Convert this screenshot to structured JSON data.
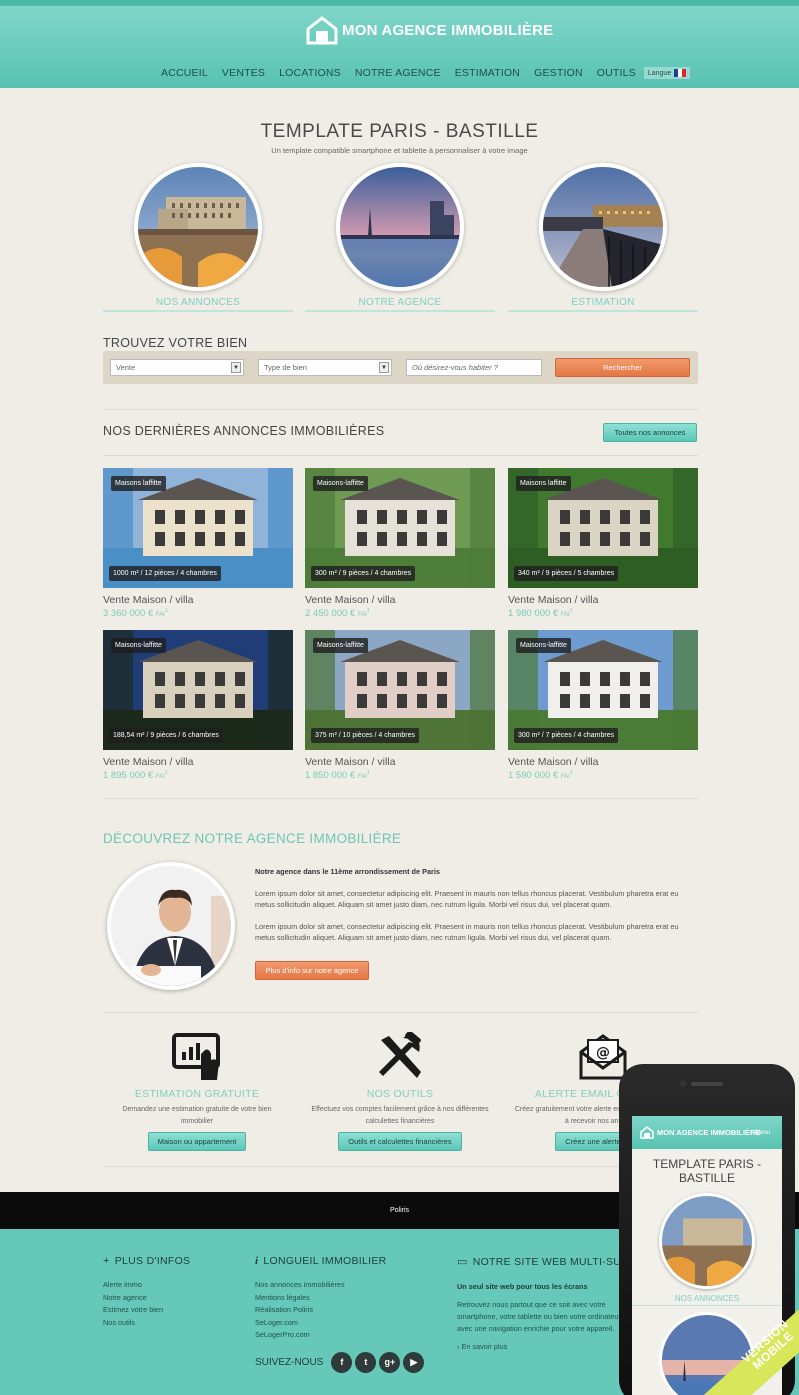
{
  "brand": {
    "name": "MON AGENCE IMMOBILIÈRE"
  },
  "nav": {
    "items": [
      "ACCUEIL",
      "VENTES",
      "LOCATIONS",
      "NOTRE AGENCE",
      "ESTIMATION",
      "GESTION",
      "OUTILS"
    ],
    "lang_label": "Langue"
  },
  "hero": {
    "title": "TEMPLATE PARIS - BASTILLE",
    "subtitle": "Un template compatible smartphone et tablette à personnaliser à votre image",
    "circles": [
      "NOS ANNONCES",
      "NOTRE AGENCE",
      "ESTIMATION"
    ]
  },
  "search": {
    "title": "TROUVEZ VOTRE BIEN",
    "select1": "Vente",
    "select2": "Type de bien",
    "placeholder": "Où désirez-vous habiter ?",
    "button": "Rechercher"
  },
  "latest": {
    "title": "NOS DERNIÈRES ANNONCES IMMOBILIÈRES",
    "all_button": "Toutes nos annonces",
    "fai": "FAI",
    "sup": "1",
    "listings": [
      {
        "city": "Maisons laffitte",
        "details": "1000 m² / 12 pièces / 4 chambres",
        "title": "Vente Maison / villa",
        "price": "3 360 000 €"
      },
      {
        "city": "Maisons-laffitte",
        "details": "300 m² / 9 pièces / 4 chambres",
        "title": "Vente Maison / villa",
        "price": "2 450 000 €"
      },
      {
        "city": "Maisons laffitte",
        "details": "340 m² / 9 pièces / 5 chambres",
        "title": "Vente Maison / villa",
        "price": "1 980 000 €"
      },
      {
        "city": "Maisons-laffitte",
        "details": "188,54 m² / 9 pièces / 6 chambres",
        "title": "Vente Maison / villa",
        "price": "1 895 000 €"
      },
      {
        "city": "Maisons-laffitte",
        "details": "375 m² / 10 pièces / 4 chambres",
        "title": "Vente Maison / villa",
        "price": "1 850 000 €"
      },
      {
        "city": "Maisons-laffitte",
        "details": "300 m² / 7 pièces / 4 chambres",
        "title": "Vente Maison / villa",
        "price": "1 590 000 €"
      }
    ]
  },
  "agency": {
    "title": "DÉCOUVREZ NOTRE AGENCE IMMOBILIÈRE",
    "heading": "Notre agence dans le 11ème arrondissement de Paris",
    "p1": "Lorem ipsum dolor sit amet, consectetur adipiscing elit. Praesent in mauris non tellus rhoncus placerat. Vestibulum pharetra erat eu metus sollicitudin aliquet. Aliquam sit amet justo diam, nec rutrum ligula. Morbi vel risus dui, vel placerat quam.",
    "p2": "Lorem ipsum dolor sit amet, consectetur adipiscing elit. Praesent in mauris non tellus rhoncus placerat. Vestibulum pharetra erat eu metus sollicitudin aliquet. Aliquam sit amet justo diam, nec rutrum ligula. Morbi vel risus dui, vel placerat quam.",
    "button": "Plus d'info sur notre agence"
  },
  "features": [
    {
      "icon": "tablet-chart-icon",
      "title": "ESTIMATION GRATUITE",
      "desc": "Demandez une estimation gratuite de votre bien immobilier",
      "button": "Maison ou appartement"
    },
    {
      "icon": "tools-icon",
      "title": "NOS OUTILS",
      "desc": "Effectuez vos comptes facilement grâce à nos différentes calculettes financières",
      "button": "Outils et calculettes financières"
    },
    {
      "icon": "email-icon",
      "title": "ALERTE EMAIL GRATUITE",
      "desc": "Créez gratuitement votre alerte email et soyez le premier à recevoir nos annonces",
      "button": "Créez une alerte email"
    }
  ],
  "strip": {
    "text": "Poliris"
  },
  "footer": {
    "col1": {
      "title": "PLUS D'INFOS",
      "items": [
        "Alerte immo",
        "Notre agence",
        "Estimez votre bien",
        "Nos outils"
      ]
    },
    "col2": {
      "title": "LONGUEIL IMMOBILIER",
      "items": [
        "Nos annonces immobilières",
        "Mentions légales",
        "Réalisation Poliris",
        "SeLoger.com",
        "SeLogerPro.com"
      ]
    },
    "col3": {
      "title": "NOTRE SITE WEB MULTI-SUPPORTS",
      "bold": "Un seul site web pour tous les écrans",
      "para": "Retrouvez nous partout que ce soit avec votre smartphone, votre tablette ou bien votre ordinateur avec une navigation enrichie pour votre appareil.",
      "link": "En savoir plus"
    },
    "follow": "SUIVEZ-NOUS",
    "social": [
      "f",
      "t",
      "g+",
      "▶"
    ]
  },
  "phone": {
    "brand": "MON AGENCE IMMOBILIÈRE",
    "menu": "Menu",
    "title": "TEMPLATE PARIS - BASTILLE",
    "label": "NOS ANNONCES"
  },
  "ribbon": {
    "text": "VERSION MOBILE"
  },
  "colors": {
    "teal": "#65c8b8",
    "orange": "#e47645",
    "black": "#0b0b0b",
    "light_green": "#d8e65a"
  }
}
